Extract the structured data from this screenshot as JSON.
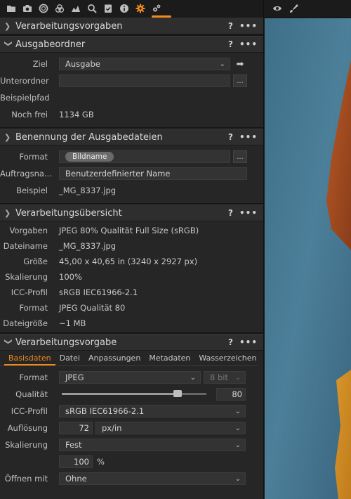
{
  "icons": [
    "folder-icon",
    "camera-icon",
    "lens-icon",
    "color-icon",
    "exposure-icon",
    "details-icon",
    "metadata-icon",
    "info-icon",
    "output-icon",
    "batch-icon"
  ],
  "right_toolbar_icons": [
    "eye-icon",
    "brush-icon"
  ],
  "colors": {
    "accent": "#f08a1c"
  },
  "panels": {
    "vorgaben": {
      "title": "Verarbeitungsvorgaben",
      "help": "?",
      "more": "•••"
    },
    "ausgabeordner": {
      "title": "Ausgabeordner",
      "help": "?",
      "more": "•••",
      "ziel_label": "Ziel",
      "ziel_value": "Ausgabe",
      "unterordner_label": "Unterordner",
      "unterordner_value": "",
      "beispielpfad_label": "Beispielpfad",
      "nochfrei_label": "Noch frei",
      "nochfrei_value": "1134 GB",
      "browse": "..."
    },
    "benennung": {
      "title": "Benennung der Ausgabedateien",
      "help": "?",
      "more": "•••",
      "format_label": "Format",
      "format_token": "Bildname",
      "auftrag_label": "Auftragsna...",
      "auftrag_value": "Benutzerdefinierter Name",
      "beispiel_label": "Beispiel",
      "beispiel_value": "_MG_8337.jpg",
      "browse": "..."
    },
    "uebersicht": {
      "title": "Verarbeitungsübersicht",
      "help": "?",
      "more": "•••",
      "rows": [
        {
          "label": "Vorgaben",
          "value": "JPEG 80% Qualität Full Size (sRGB)"
        },
        {
          "label": "Dateiname",
          "value": "_MG_8337.jpg"
        },
        {
          "label": "Größe",
          "value": "45,00 x 40,65 in (3240 x 2927 px)"
        },
        {
          "label": "Skalierung",
          "value": "100%"
        },
        {
          "label": "ICC-Profil",
          "value": "sRGB IEC61966-2.1"
        },
        {
          "label": "Format",
          "value": "JPEG Qualität 80"
        },
        {
          "label": "Dateigröße",
          "value": "~1 MB"
        }
      ]
    },
    "vorgabe": {
      "title": "Verarbeitungsvorgabe",
      "help": "?",
      "more": "•••",
      "tabs": [
        "Basisdaten",
        "Datei",
        "Anpassungen",
        "Metadaten",
        "Wasserzeichen"
      ],
      "format_label": "Format",
      "format_value": "JPEG",
      "bit_value": "8 bit",
      "qualitaet_label": "Qualität",
      "qualitaet_value": "80",
      "qualitaet_fraction": 0.8,
      "icc_label": "ICC-Profil",
      "icc_value": "sRGB IEC61966-2.1",
      "aufloesung_label": "Auflösung",
      "aufloesung_value": "72",
      "aufloesung_unit": "px/in",
      "skalierung_label": "Skalierung",
      "skalierung_value": "Fest",
      "scale_percent_value": "100",
      "scale_percent_unit": "%",
      "oeffnen_label": "Öffnen mit",
      "oeffnen_value": "Ohne"
    }
  }
}
